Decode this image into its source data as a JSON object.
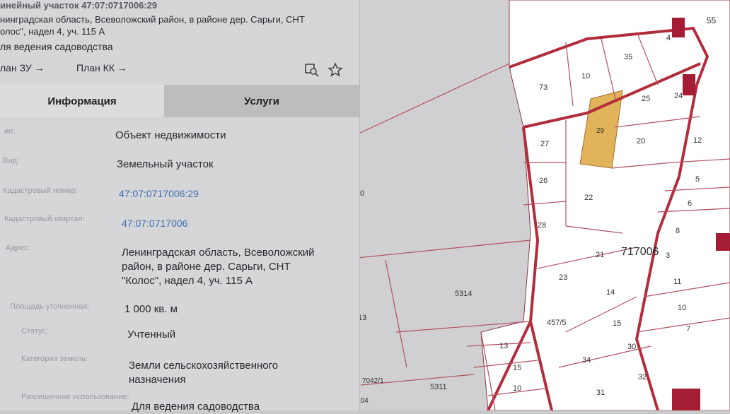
{
  "header": {
    "title_fragment": "инейный участок 47:07:0717006:29",
    "address_line1": "нинградская область, Всеволожский район, в районе дер. Сарьги, СНТ",
    "address_line2": "олос\", надел 4, уч. 115 А",
    "usage": "ля ведения садоводства",
    "link_plan_zu": "лан ЗУ →",
    "link_plan_kk": "План КК →"
  },
  "icons": {
    "search": "search-icon",
    "star": "star-icon"
  },
  "tabs": [
    {
      "label": "Информация"
    },
    {
      "label": "Услуги"
    }
  ],
  "fields": [
    {
      "label": "ип:",
      "value": "Объект недвижимости"
    },
    {
      "label": "Вид:",
      "value": "Земельный участок"
    },
    {
      "label": "Кадастровый номер:",
      "value": "47:07:0717006:29"
    },
    {
      "label": "Кадастровый квартал:",
      "value": "47:07:0717006"
    },
    {
      "label": "Адрес:",
      "value_lines": [
        "Ленинградская область, Всеволожский",
        "район, в районе дер. Сарьги, СНТ",
        "\"Колос\", надел 4, уч. 115 А"
      ]
    },
    {
      "label": "Площадь уточненная:",
      "value": "1 000 кв. м"
    },
    {
      "label": "Статус:",
      "value": "Учтенный"
    },
    {
      "label": "Категория земель:",
      "value_lines": [
        "Земли сельскохозяйственного",
        "назначения"
      ]
    },
    {
      "label": "Разрешенное использование:",
      "value": "Для ведения садоводства"
    }
  ],
  "map": {
    "quarter_label": "717006",
    "lots": [
      "55",
      "4",
      "35",
      "10",
      "73",
      "25",
      "24",
      "29",
      "27",
      "20",
      "12",
      "26",
      "5",
      "22",
      "6",
      "28",
      "8",
      "21",
      "23",
      "3",
      "14",
      "11",
      "10",
      "15",
      "457/5",
      "13",
      "30",
      "7",
      "13",
      "34",
      "15",
      "32",
      "7042/1",
      "5311",
      "10",
      "31",
      "104",
      "5314",
      "0",
      "13"
    ],
    "colors": {
      "boundary": "#b32c3c",
      "selected_fill": "#e1b35a",
      "parcel": "#ffffff"
    }
  }
}
